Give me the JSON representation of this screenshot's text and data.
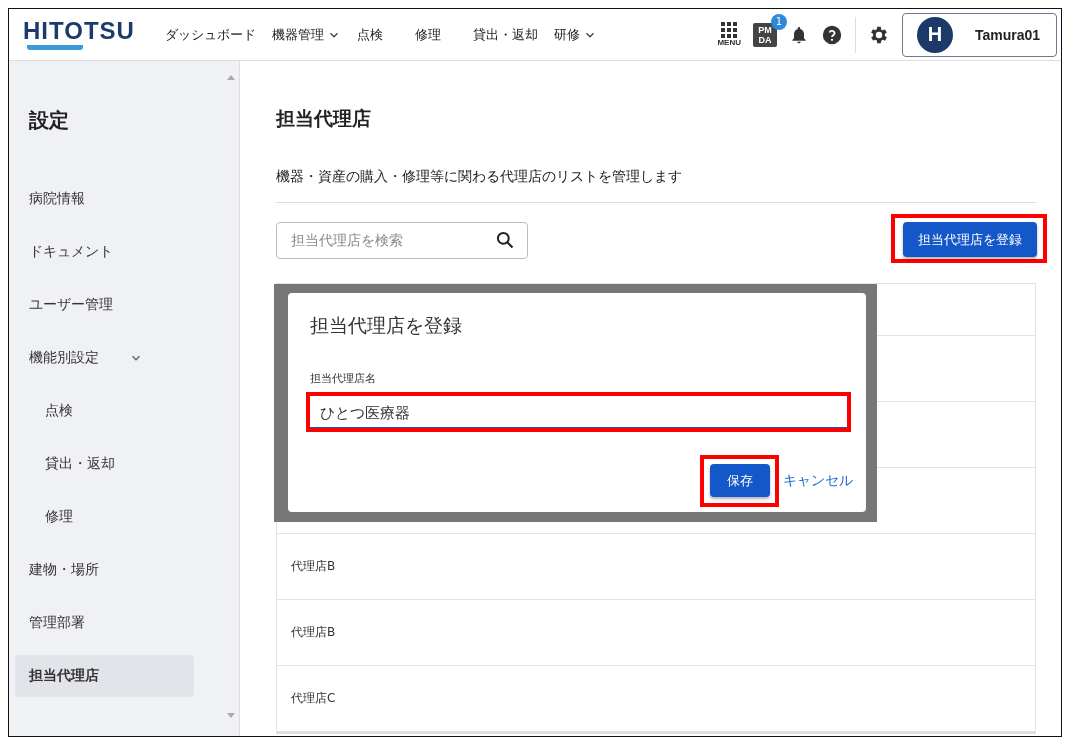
{
  "header": {
    "logo": "HITOTSU",
    "nav": [
      {
        "label": "ダッシュボード",
        "dropdown": false
      },
      {
        "label": "機器管理",
        "dropdown": true
      },
      {
        "label": "点検",
        "dropdown": false
      },
      {
        "label": "修理",
        "dropdown": false
      },
      {
        "label": "貸出・返却",
        "dropdown": false
      },
      {
        "label": "研修",
        "dropdown": true
      }
    ],
    "menu_label": "MENU",
    "pmda_icon_text": [
      "PM",
      "DA"
    ],
    "notification_badge": "1",
    "avatar_letter": "H",
    "user_name": "Tamura01"
  },
  "sidebar": {
    "title": "設定",
    "items": [
      {
        "label": "病院情報",
        "selected": false
      },
      {
        "label": "ドキュメント",
        "selected": false
      },
      {
        "label": "ユーザー管理",
        "selected": false
      },
      {
        "label": "機能別設定",
        "selected": false,
        "expanded": true,
        "children": [
          {
            "label": "点検",
            "selected": false
          },
          {
            "label": "貸出・返却",
            "selected": false
          },
          {
            "label": "修理",
            "selected": false
          }
        ]
      },
      {
        "label": "建物・場所",
        "selected": false
      },
      {
        "label": "管理部署",
        "selected": false
      },
      {
        "label": "担当代理店",
        "selected": true
      }
    ]
  },
  "page": {
    "title": "担当代理店",
    "description": "機器・資産の購入・修理等に関わる代理店のリストを管理します",
    "search": {
      "placeholder": "担当代理店を検索"
    },
    "register_button": {
      "label": "担当代理店を登録",
      "highlighted": true
    }
  },
  "table": {
    "rows": [
      {
        "name": "代理店B"
      },
      {
        "name": "代理店B"
      },
      {
        "name": "代理店C"
      }
    ]
  },
  "dialog": {
    "title": "担当代理店を登録",
    "field": {
      "label": "担当代理店名",
      "value": "ひとつ医療器",
      "highlighted": true
    },
    "save_button": {
      "label": "保存",
      "highlighted": true
    },
    "cancel_link": "キャンセル"
  }
}
